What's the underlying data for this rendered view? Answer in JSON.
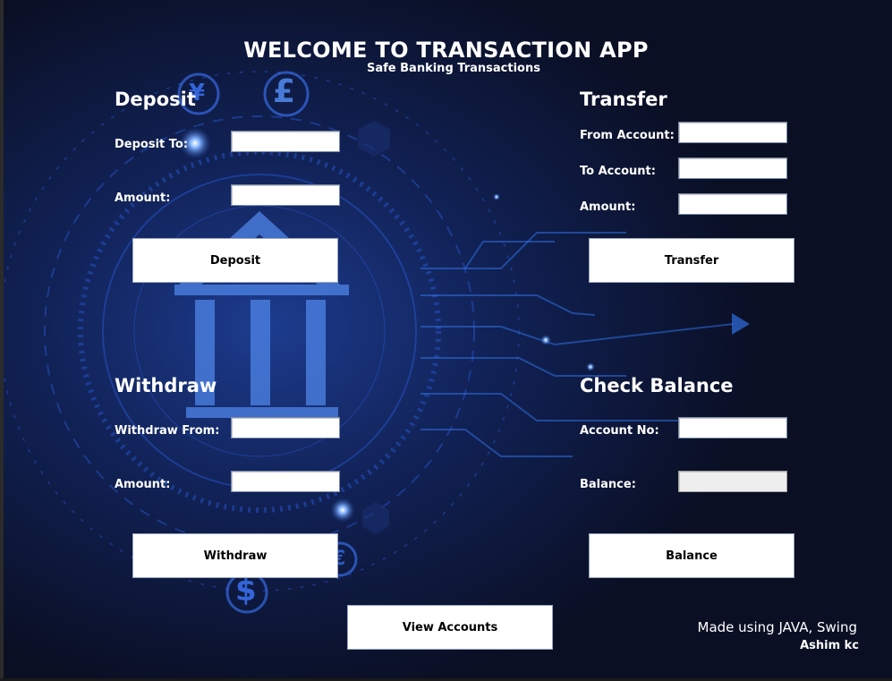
{
  "header": {
    "title": "WELCOME TO TRANSACTION APP",
    "subtitle": "Safe Banking Transactions"
  },
  "deposit": {
    "heading": "Deposit",
    "to_label": "Deposit To:",
    "to_value": "",
    "amount_label": "Amount:",
    "amount_value": "",
    "button": "Deposit"
  },
  "transfer": {
    "heading": "Transfer",
    "from_label": "From Account:",
    "from_value": "",
    "to_label": "To Account:",
    "to_value": "",
    "amount_label": "Amount:",
    "amount_value": "",
    "button": "Transfer"
  },
  "withdraw": {
    "heading": "Withdraw",
    "from_label": "Withdraw From:",
    "from_value": "",
    "amount_label": "Amount:",
    "amount_value": "",
    "button": "Withdraw"
  },
  "balance": {
    "heading": "Check Balance",
    "account_label": "Account No:",
    "account_value": "",
    "balance_label": "Balance:",
    "balance_value": "",
    "button": "Balance"
  },
  "footer": {
    "view_accounts_button": "View Accounts",
    "credit_line1": "Made using JAVA, Swing",
    "credit_line2": "Ashim kc"
  },
  "background": {
    "symbols": [
      "¥",
      "£",
      "$",
      "€"
    ],
    "accent_color": "#3d78ff",
    "base_color": "#0a0f24"
  }
}
